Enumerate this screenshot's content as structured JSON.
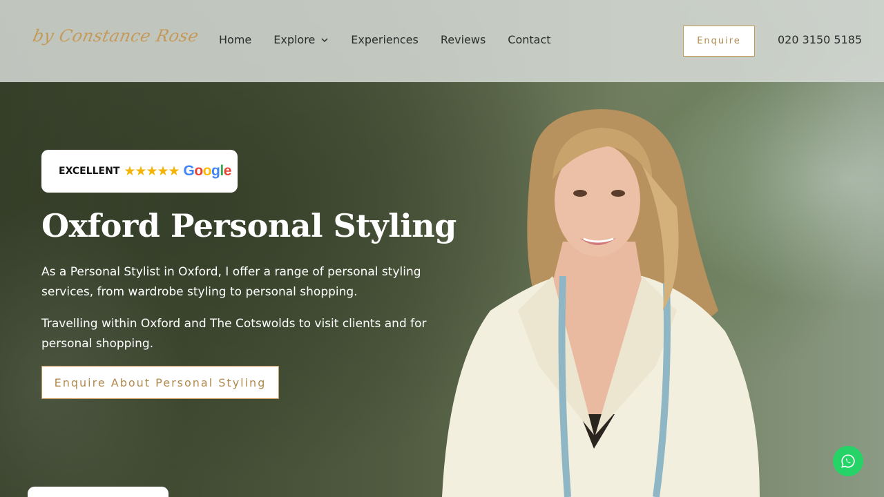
{
  "header": {
    "logo": "by Constance Rose",
    "nav": [
      {
        "label": "Home"
      },
      {
        "label": "Explore"
      },
      {
        "label": "Experiences"
      },
      {
        "label": "Reviews"
      },
      {
        "label": "Contact"
      }
    ],
    "enquire_label": "Enquire",
    "phone": "020 3150 5185"
  },
  "badge": {
    "label": "EXCELLENT",
    "stars": "★★★★★",
    "google_letters": [
      "G",
      "o",
      "o",
      "g",
      "l",
      "e"
    ]
  },
  "hero": {
    "title": "Oxford Personal Styling",
    "paragraph1": "As a Personal Stylist in Oxford, I offer a range of personal styling services, from wardrobe styling to personal shopping.",
    "paragraph2": "Travelling within Oxford and The Cotswolds to visit clients and for personal shopping.",
    "cta_label": "Enquire About Personal Styling"
  },
  "colors": {
    "accent": "#c49a5a",
    "whatsapp": "#25d366",
    "star": "#f5b400",
    "google_blue": "#4285f4",
    "google_red": "#ea4335",
    "google_yellow": "#fbbc05",
    "google_green": "#34a853"
  },
  "icons": {
    "explore_dropdown": "chevron-down-icon",
    "whatsapp": "whatsapp-icon"
  }
}
